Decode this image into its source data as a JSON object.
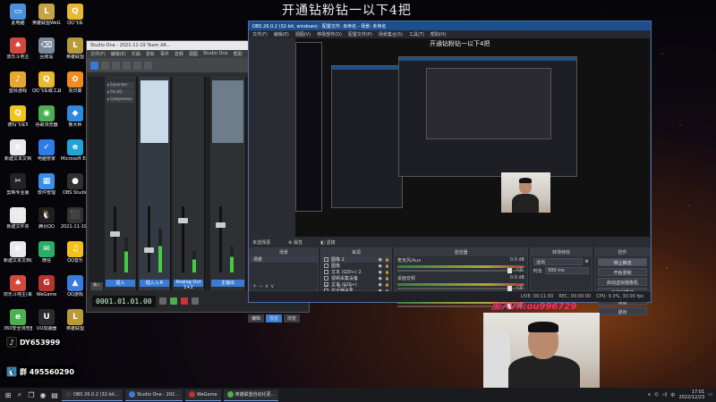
{
  "overlay": {
    "top_title": "开通钻粉钻一以下4把",
    "vx_text": "加入VX:ou996729",
    "douyin_id": "DY653999",
    "qq_group": "群 495560290"
  },
  "desktop_icons": [
    {
      "label": "此电脑",
      "color": "#4a90d9",
      "glyph": "▭"
    },
    {
      "label": "英雄联盟WeGame版",
      "color": "#c7a443",
      "glyph": "L"
    },
    {
      "label": "QQ飞车",
      "color": "#e8b830",
      "glyph": "Q"
    },
    {
      "label": "双乐斗地主",
      "color": "#d24a3c",
      "glyph": "♠"
    },
    {
      "label": "回收站",
      "color": "#7a8a9c",
      "glyph": "⌫"
    },
    {
      "label": "英雄联盟",
      "color": "#b89a3a",
      "glyph": "L"
    },
    {
      "label": "蓝铃游戏",
      "color": "#e7a82d",
      "glyph": "♪"
    },
    {
      "label": "QQ飞车敢工具",
      "color": "#e8b830",
      "glyph": "Q"
    },
    {
      "label": "向日葵",
      "color": "#f08c1d",
      "glyph": "✿"
    },
    {
      "label": "德玛飞车5",
      "color": "#f0c41d",
      "glyph": "Q"
    },
    {
      "label": "谷歌浏览器",
      "color": "#4caf50",
      "glyph": "◉"
    },
    {
      "label": "鲁大师",
      "color": "#2d8ae0",
      "glyph": "◆"
    },
    {
      "label": "新建文本文档",
      "color": "#e9e9e9",
      "glyph": "≡"
    },
    {
      "label": "电脑管家",
      "color": "#2f7be8",
      "glyph": "✓"
    },
    {
      "label": "Microsoft Edge",
      "color": "#1fa3d8",
      "glyph": "e"
    },
    {
      "label": "剪映专业版",
      "color": "#222222",
      "glyph": "✂"
    },
    {
      "label": "软件管理",
      "color": "#3a8ee6",
      "glyph": "▦"
    },
    {
      "label": "OBS Studio",
      "color": "#303030",
      "glyph": "●"
    },
    {
      "label": "新建文件夹",
      "color": "#e9e9e9",
      "glyph": "▢"
    },
    {
      "label": "腾讯QQ",
      "color": "#1f1f1f",
      "glyph": "🐧"
    },
    {
      "label": "2021-11-19 Team AR...",
      "color": "#333333",
      "glyph": "⬛"
    },
    {
      "label": "新建文本文档(4)",
      "color": "#e9e9e9",
      "glyph": "≡"
    },
    {
      "label": "微信",
      "color": "#2aae67",
      "glyph": "✉"
    },
    {
      "label": "QQ音乐",
      "color": "#f2c21b",
      "glyph": "♫"
    },
    {
      "label": "欢乐斗地主(来源手机)",
      "color": "#d24a3c",
      "glyph": "♠"
    },
    {
      "label": "WeGame",
      "color": "#b8332d",
      "glyph": "G"
    },
    {
      "label": "QQ游戏",
      "color": "#3a7be0",
      "glyph": "▲"
    },
    {
      "label": "360安全浏览器",
      "color": "#4caf50",
      "glyph": "e"
    },
    {
      "label": "UU加速器",
      "color": "#2b2b2b",
      "glyph": "U"
    },
    {
      "label": "英雄联盟",
      "color": "#b89a3a",
      "glyph": "L"
    }
  ],
  "studio_one": {
    "title": "Studio One - 2021-11-19 Team AR...",
    "menu": [
      "文件(F)",
      "编辑(E)",
      "乐曲",
      "音轨",
      "事件",
      "音频",
      "视图",
      "Studio One",
      "帮助"
    ],
    "timecode": "0001.01.01.00",
    "channels": [
      {
        "label": "插入"
      },
      {
        "label": "插入 L-R"
      },
      {
        "label": "Analog Out 1+2"
      },
      {
        "label": "主输出"
      }
    ],
    "side_tabs": [
      "输入",
      "输出",
      "外部"
    ],
    "bottom_tabs": [
      "编辑",
      "混音",
      "浏览"
    ]
  },
  "obs": {
    "title": "OBS 26.0.2 (32-bit, windows) - 配置文件: 未命名 - 场景: 未命名",
    "menu": [
      "文件(F)",
      "编辑(E)",
      "视图(V)",
      "停靠部件(D)",
      "配置文件(P)",
      "场景集合(S)",
      "工具(T)",
      "帮助(H)"
    ],
    "preview_title": "开通钻粉钻一以下4把",
    "scene_bar": {
      "label": "未选择源",
      "properties": "属性",
      "filters": "滤镜"
    },
    "docks": {
      "scenes": {
        "title": "场景",
        "items": [
          "场景"
        ]
      },
      "sources": {
        "title": "来源",
        "items": [
          "图像 2",
          "图像",
          "文本 (GDI+) 2",
          "视频采集设备",
          "文本 (GDI+)",
          "显示器采集"
        ]
      },
      "mixer": {
        "title": "混音器",
        "channels": [
          {
            "name": "麦克风/Aux",
            "db": "0.0 dB"
          },
          {
            "name": "桌面音频",
            "db": "0.0 dB"
          },
          {
            "name": "桌面音频",
            "db": "0.0 dB"
          }
        ]
      },
      "transitions": {
        "title": "转场特效",
        "type": "淡出",
        "duration_label": "时长",
        "duration": "300 ms"
      },
      "controls": {
        "title": "控件",
        "buttons": [
          "停止推流",
          "开始录制",
          "启动虚拟摄像机",
          "工作室模式",
          "设置",
          "退出"
        ]
      }
    },
    "statusbar": {
      "ltr": "LIVE: 00:11:00",
      "rec": "REC: 00:00:00",
      "cpu": "CPU: 9.3%, 30.00 fps"
    }
  },
  "taskbar": {
    "apps": [
      {
        "label": "OBS 26.0.2 (32-bit...",
        "color": "#3a3a3a"
      },
      {
        "label": "Studio One - 202...",
        "color": "#3a7bd5"
      },
      {
        "label": "WeGame",
        "color": "#b8332d"
      },
      {
        "label": "英雄联盟自动化更...",
        "color": "#4caf50"
      }
    ],
    "time": "17:01",
    "date": "2022/12/23"
  }
}
